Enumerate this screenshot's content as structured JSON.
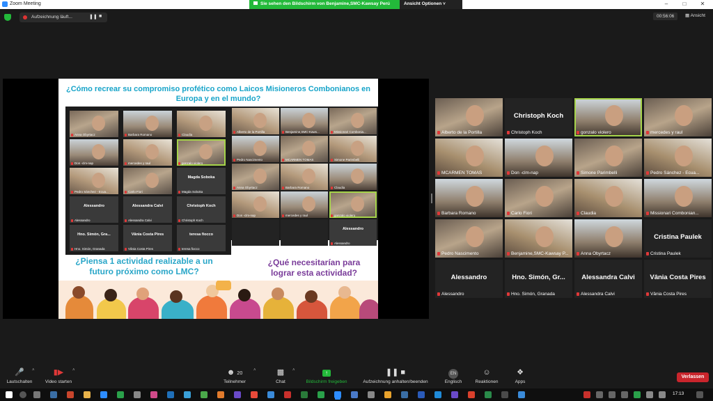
{
  "window": {
    "title": "Zoom Meeting"
  },
  "share_banner": {
    "text": "Sie sehen den Bildschirm von Benjamine,SMC-Kawsay Perú",
    "view_options": "Ansicht Optionen"
  },
  "recording": {
    "label": "Aufzeichnung läuft..."
  },
  "timer": "00:56:06",
  "view_button": "Ansicht",
  "slide": {
    "question_top": "¿Cómo recrear su compromiso profético como Laicos Misioneros Combonianos en Europa y en el mundo?",
    "question_left": "¿Piensa 1 actividad realizable a un futuro próximo como LMC?",
    "question_right": "¿Qué necesitarían para lograr esta actividad?",
    "gallery_a": [
      {
        "name": "Anna Obyrtacz"
      },
      {
        "name": "Barbara Romano"
      },
      {
        "name": "Claudia"
      },
      {
        "name": "Don -clm-nap"
      },
      {
        "name": "mercedes y raul"
      },
      {
        "name": "gonzalo violero"
      },
      {
        "name": "Pedro Sánchez - Ecua..."
      },
      {
        "name": "Carlo Fiori"
      },
      {
        "name": "Magda Soboka",
        "big": "Magda Soboka"
      },
      {
        "name": "Alessandro",
        "big": "Alessandro"
      },
      {
        "name": "Alessandra Calvi",
        "big": "Alessandra Calvi"
      },
      {
        "name": "Christoph Koch",
        "big": "Christoph Koch"
      },
      {
        "name": "Hno. Simón, Granada",
        "big": "Hno. Simón, Gra..."
      },
      {
        "name": "Vânia Costa Pires",
        "big": "Vânia Costa Pires"
      },
      {
        "name": "teresa fiocco",
        "big": "teresa fiocco"
      }
    ],
    "gallery_b": [
      {
        "name": "Alberto de la Portilla"
      },
      {
        "name": "Benjamine,SMC-Kaws..."
      },
      {
        "name": "Missionari Combonia..."
      },
      {
        "name": "Pedro Nascimento"
      },
      {
        "name": "MCARMEN TOMAS"
      },
      {
        "name": "Simone Parimbelli"
      },
      {
        "name": "Anna Obyrtacz"
      },
      {
        "name": "Barbara Romano"
      },
      {
        "name": "Claudia"
      },
      {
        "name": "Don -clm-nap"
      },
      {
        "name": "mercedes y raul"
      },
      {
        "name": "gonzalo violero"
      },
      {
        "name": ""
      },
      {
        "name": ""
      },
      {
        "name": "Alessandro",
        "big": "Alessandro"
      }
    ]
  },
  "gallery": [
    {
      "name": "Alberto de la Portilla"
    },
    {
      "name": "Christoph Koch",
      "big": "Christoph Koch"
    },
    {
      "name": "gonzalo violero"
    },
    {
      "name": "mercedes y raul"
    },
    {
      "name": "MCARMEN TOMAS"
    },
    {
      "name": "Don -clm-nap"
    },
    {
      "name": "Simone Parimbelli"
    },
    {
      "name": "Pedro Sánchez - Ecua..."
    },
    {
      "name": "Barbara Romano"
    },
    {
      "name": "Carlo Fiori"
    },
    {
      "name": "Claudia"
    },
    {
      "name": "Missionari Combonian..."
    },
    {
      "name": "Pedro Nascimento"
    },
    {
      "name": "Benjamine,SMC-Kawsay P..."
    },
    {
      "name": "Anna Obyrtacz"
    },
    {
      "name": "Cristina Paulek",
      "big": "Cristina Paulek"
    },
    {
      "name": "Alessandro",
      "big": "Alessandro"
    },
    {
      "name": "Hno. Simón, Granada",
      "big": "Hno. Simón, Gr..."
    },
    {
      "name": "Alessandra Calvi",
      "big": "Alessandra Calvi"
    },
    {
      "name": "Vânia Costa Pires",
      "big": "Vânia Costa Pires"
    }
  ],
  "toolbar": {
    "mute": "Lautschalten",
    "video": "Video starten",
    "participants": "Teilnehmer",
    "participant_count": "20",
    "chat": "Chat",
    "share": "Bildschirm freigeben",
    "record": "Aufzeichnung anhalten/beenden",
    "language": "Englisch",
    "language_badge": "EN",
    "reactions": "Reaktionen",
    "apps": "Apps",
    "leave": "Verlassen"
  },
  "taskbar": {
    "time": "17:13"
  },
  "colors": {
    "accent_green": "#23b93a",
    "leave_red": "#c9252c",
    "highlight": "#a6d44a",
    "slide_blue": "#17a4c9",
    "slide_purple": "#7a3c9a"
  }
}
